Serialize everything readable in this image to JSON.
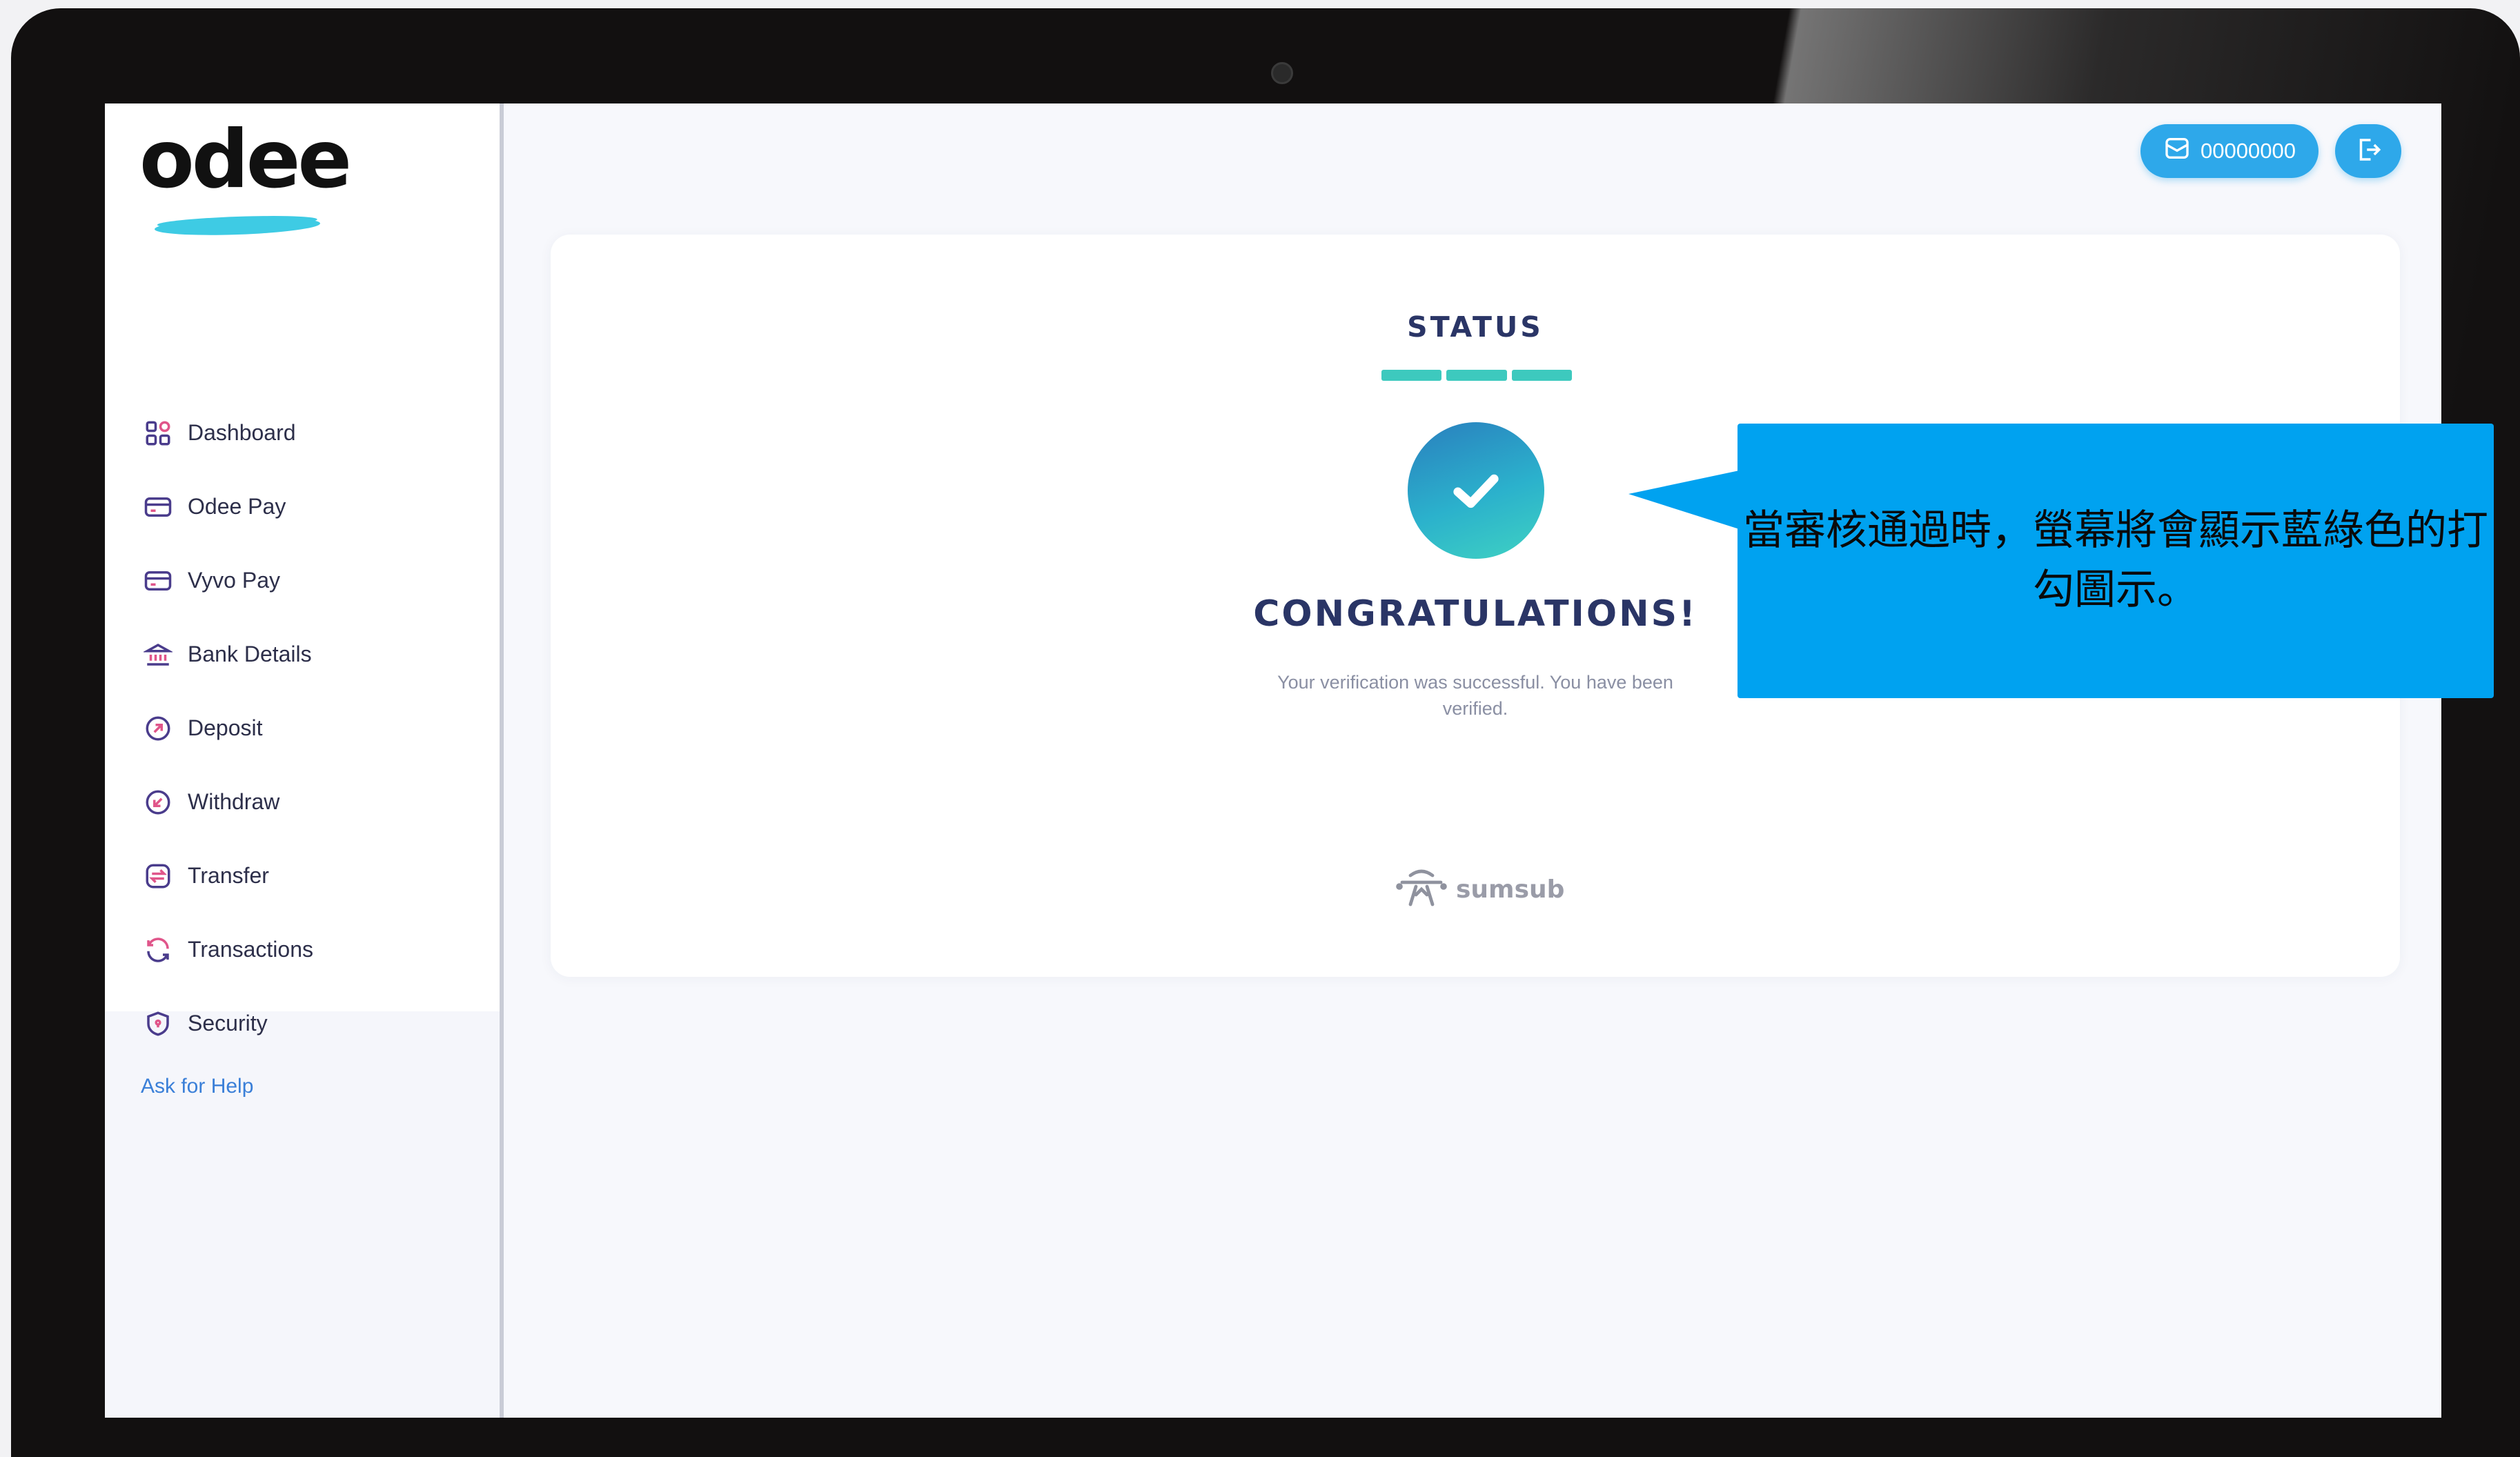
{
  "brand": {
    "logo_text": "odee"
  },
  "sidebar": {
    "items": [
      {
        "label": "Dashboard",
        "icon": "dashboard-icon"
      },
      {
        "label": "Odee Pay",
        "icon": "card-icon"
      },
      {
        "label": "Vyvo Pay",
        "icon": "card-icon"
      },
      {
        "label": "Bank Details",
        "icon": "bank-icon"
      },
      {
        "label": "Deposit",
        "icon": "deposit-arrow-icon"
      },
      {
        "label": "Withdraw",
        "icon": "withdraw-arrow-icon"
      },
      {
        "label": "Transfer",
        "icon": "transfer-icon"
      },
      {
        "label": "Transactions",
        "icon": "refresh-icon"
      },
      {
        "label": "Security",
        "icon": "shield-icon"
      }
    ],
    "help_link": "Ask for Help"
  },
  "header": {
    "account_number": "00000000",
    "account_icon": "wallet-icon",
    "logout_icon": "logout-icon"
  },
  "status_card": {
    "title": "STATUS",
    "progress_steps_complete": 3,
    "progress_steps_total": 3,
    "heading": "CONGRATULATIONS!",
    "message": "Your verification was successful. You have been verified.",
    "provider": "sumsub"
  },
  "callout": {
    "text": "當審核通過時，螢幕將會顯示藍綠色的打勾圖示。"
  },
  "colors": {
    "accent_blue": "#2ea8ea",
    "teal": "#3dc9be",
    "heading_navy": "#2a3566",
    "callout_blue": "#00a2f0"
  }
}
